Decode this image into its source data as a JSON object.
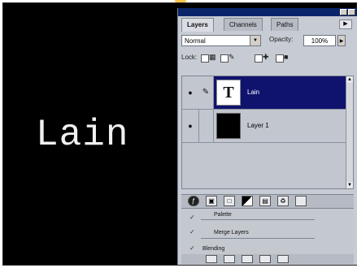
{
  "canvas": {
    "text": "Lain"
  },
  "layers_panel": {
    "tabs": [
      {
        "label": "Layers",
        "active": true
      },
      {
        "label": "Channels",
        "active": false
      },
      {
        "label": "Paths",
        "active": false
      }
    ],
    "blend_mode": "Normal",
    "opacity_label": "Opacity:",
    "opacity_value": "100%",
    "lock_label": "Lock:",
    "layers": [
      {
        "name": "Lain",
        "type": "text",
        "thumb_glyph": "T",
        "selected": true
      },
      {
        "name": "Layer 1",
        "type": "fill",
        "selected": false
      }
    ]
  },
  "context_menu": {
    "items": [
      "Palette",
      "Merge Layers",
      "Blending"
    ]
  },
  "colors": {
    "canvas_bg": "#000000",
    "selection": "#10136d",
    "panel_bg": "#c7cbd3",
    "accent": "#f7c64a"
  }
}
